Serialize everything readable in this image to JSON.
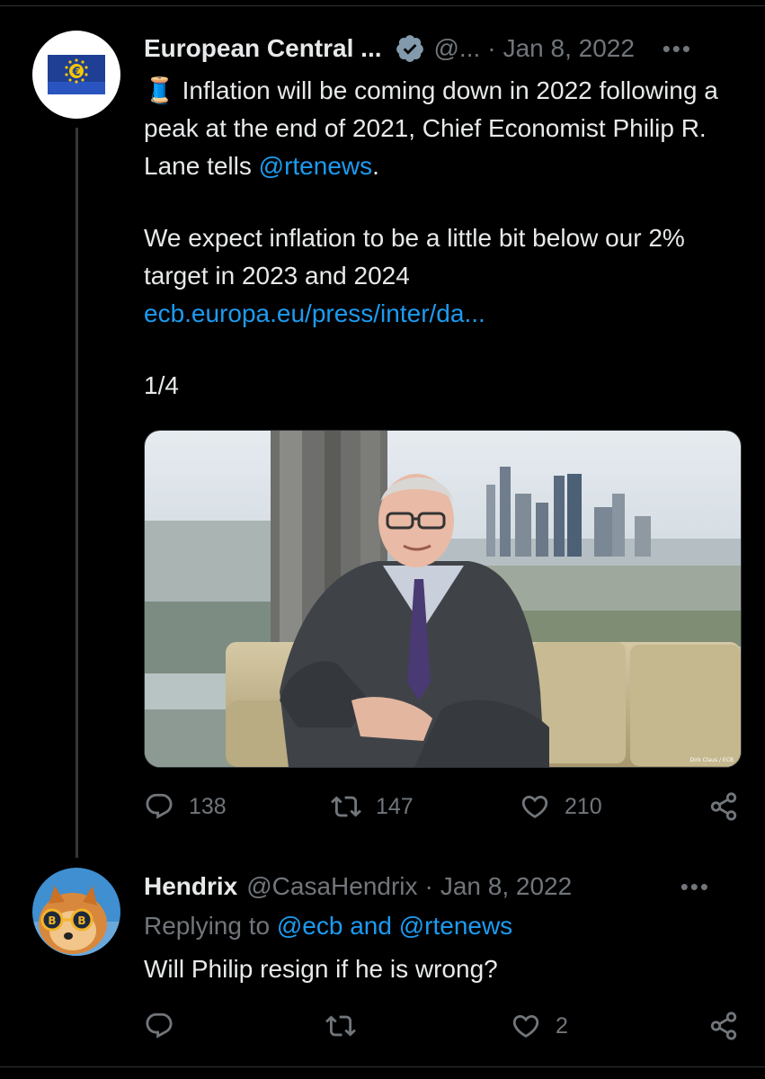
{
  "tweet": {
    "author_name": "European Central ...",
    "author_handle": "@...",
    "date": "Jan 8, 2022",
    "more_label": "•••",
    "text_line1_emoji": "🧵",
    "text_line1": " Inflation will be coming down in 2022 following a peak at the end of 2021, Chief Economist Philip R. Lane tells ",
    "mention": "@rtenews",
    "text_line1_end": ".",
    "text_line2": "We expect inflation to be a little bit below our 2% target in 2023 and 2024",
    "link": "ecb.europa.eu/press/inter/da...",
    "thread_count": "1/4",
    "photo_credit": "Dirk Claus / ECB",
    "replies": "138",
    "retweets": "147",
    "likes": "210"
  },
  "reply": {
    "author_name": "Hendrix",
    "author_handle": "@CasaHendrix",
    "date": "Jan 8, 2022",
    "more_label": "•••",
    "replying_prefix": "Replying to ",
    "replying_to": "@ecb and @rtenews",
    "text": "Will Philip resign if he is wrong?",
    "replies": "",
    "retweets": "",
    "likes": "2"
  },
  "colors": {
    "background": "#000000",
    "text": "#e7e9ea",
    "muted": "#71767b",
    "link": "#1d9bf0",
    "verified_badge": "#829aab"
  },
  "icons": [
    "verified-badge-icon",
    "reply-icon",
    "retweet-icon",
    "like-icon",
    "share-icon",
    "more-icon"
  ]
}
